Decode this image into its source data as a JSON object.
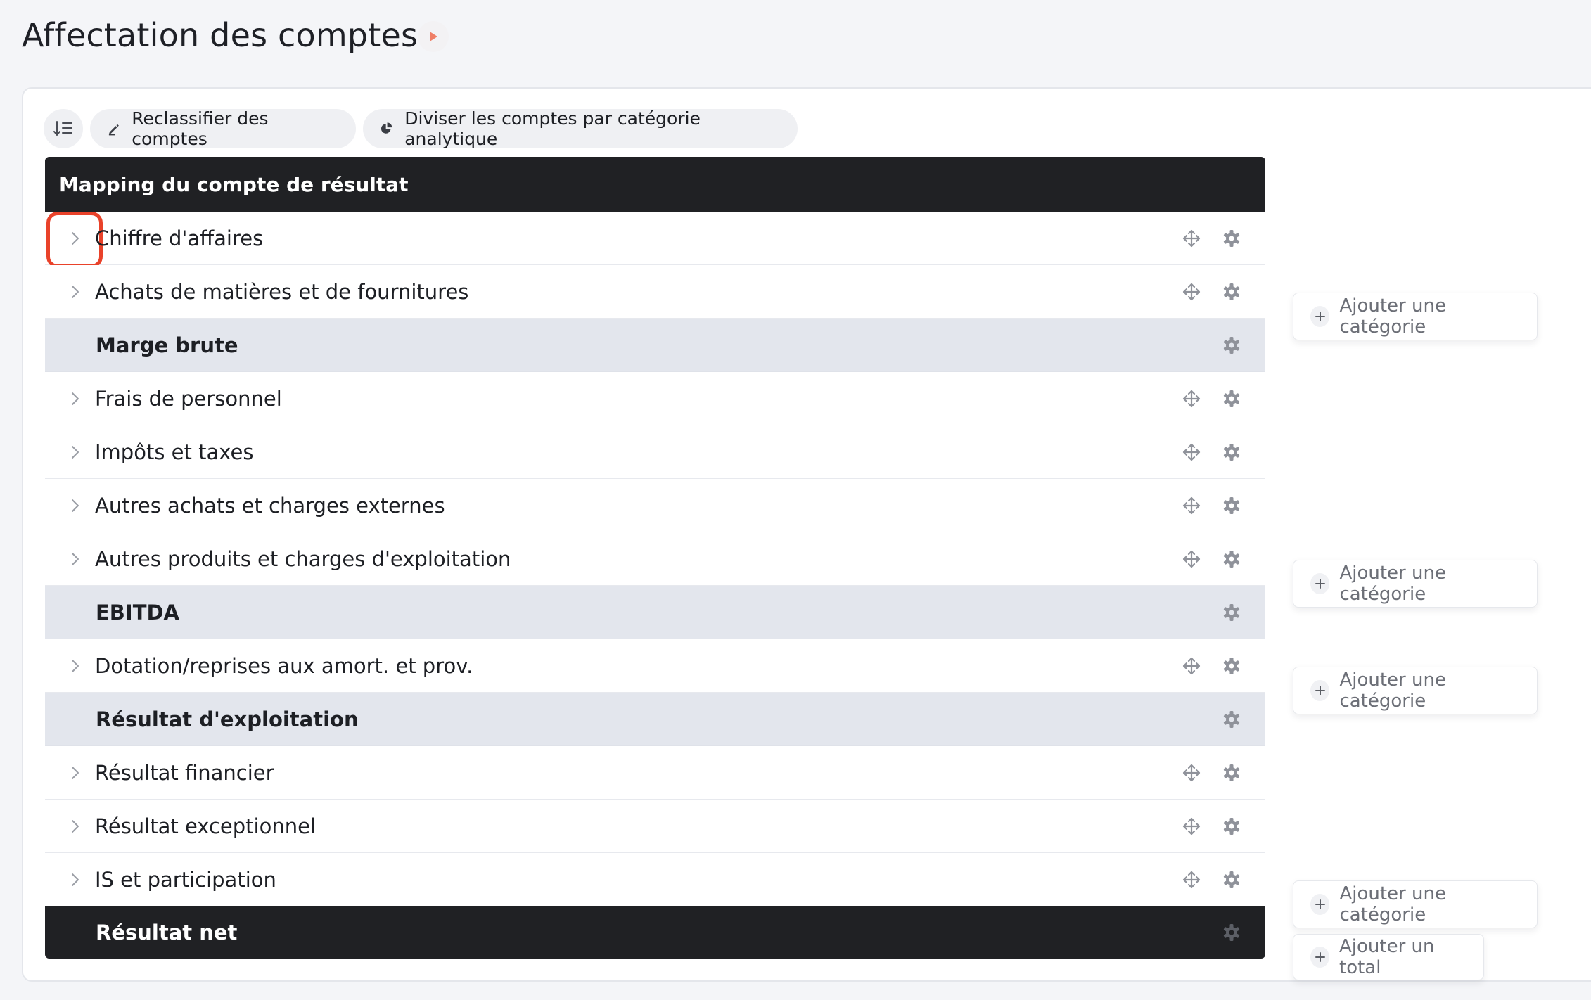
{
  "page": {
    "title": "Affectation des comptes"
  },
  "toolbar": {
    "reclassify_label": "Reclassifier des comptes",
    "split_label": "Diviser les comptes par catégorie analytique"
  },
  "table": {
    "header": "Mapping du compte de résultat",
    "rows": [
      {
        "label": "Chiffre d'affaires",
        "type": "category"
      },
      {
        "label": "Achats de matières et de fournitures",
        "type": "category"
      },
      {
        "label": "Marge brute",
        "type": "subtotal"
      },
      {
        "label": "Frais de personnel",
        "type": "category"
      },
      {
        "label": "Impôts et taxes",
        "type": "category"
      },
      {
        "label": "Autres achats et charges externes",
        "type": "category"
      },
      {
        "label": "Autres produits et charges d'exploitation",
        "type": "category"
      },
      {
        "label": "EBITDA",
        "type": "subtotal"
      },
      {
        "label": "Dotation/reprises aux amort. et prov.",
        "type": "category"
      },
      {
        "label": "Résultat d'exploitation",
        "type": "subtotal"
      },
      {
        "label": "Résultat financier",
        "type": "category"
      },
      {
        "label": "Résultat exceptionnel",
        "type": "category"
      },
      {
        "label": "IS et participation",
        "type": "category"
      },
      {
        "label": "Résultat net",
        "type": "total"
      }
    ]
  },
  "side_actions": {
    "add_category_label": "Ajouter une catégorie",
    "add_total_label": "Ajouter un total"
  },
  "colors": {
    "accent": "#e9422a",
    "header_bg": "#202124",
    "subtotal_bg": "#e3e6ed",
    "page_bg": "#f4f5f8"
  }
}
